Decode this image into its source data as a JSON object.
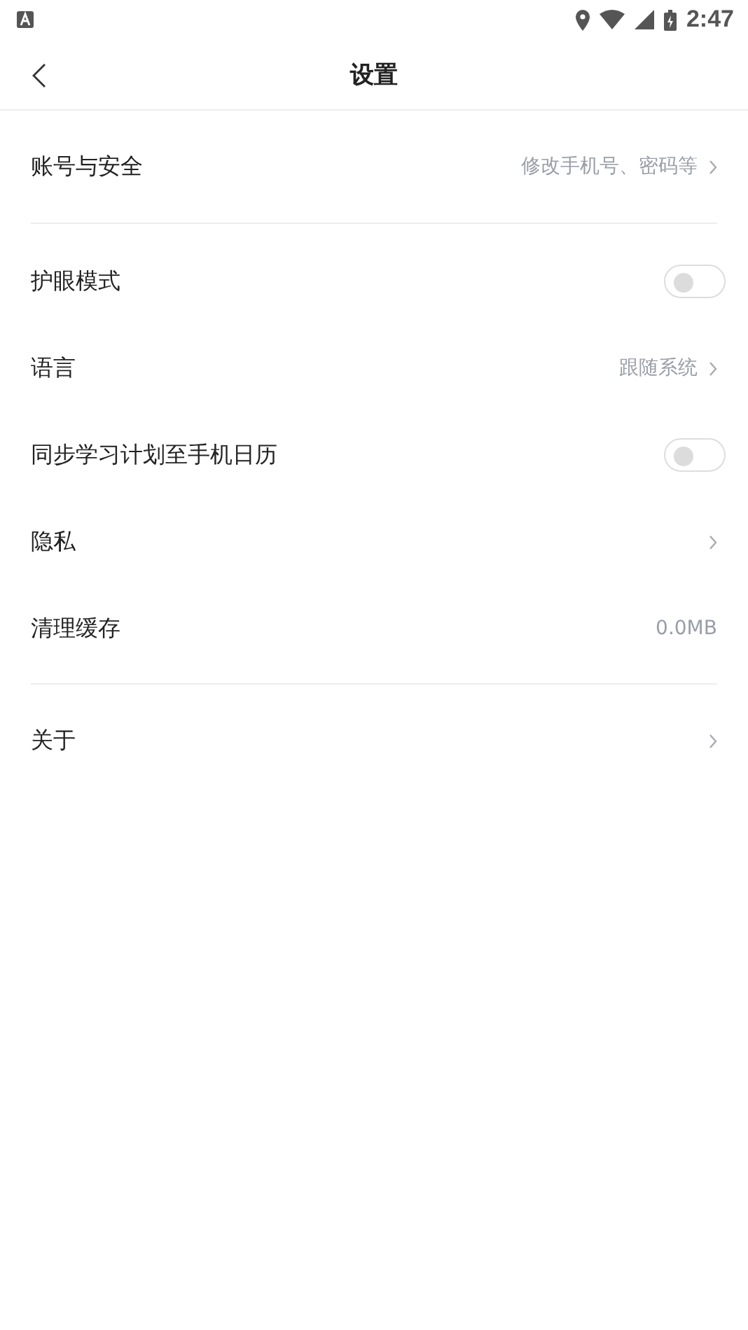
{
  "status_bar": {
    "time": "2:47"
  },
  "header": {
    "title": "设置"
  },
  "sections": [
    {
      "items": [
        {
          "kind": "link",
          "label": "账号与安全",
          "value": "修改手机号、密码等"
        }
      ]
    },
    {
      "items": [
        {
          "kind": "toggle",
          "label": "护眼模式",
          "on": false
        },
        {
          "kind": "link",
          "label": "语言",
          "value": "跟随系统"
        },
        {
          "kind": "toggle",
          "label": "同步学习计划至手机日历",
          "on": false
        },
        {
          "kind": "link",
          "label": "隐私"
        },
        {
          "kind": "value",
          "label": "清理缓存",
          "value": "0.0MB"
        }
      ]
    },
    {
      "items": [
        {
          "kind": "link",
          "label": "关于"
        }
      ]
    }
  ]
}
